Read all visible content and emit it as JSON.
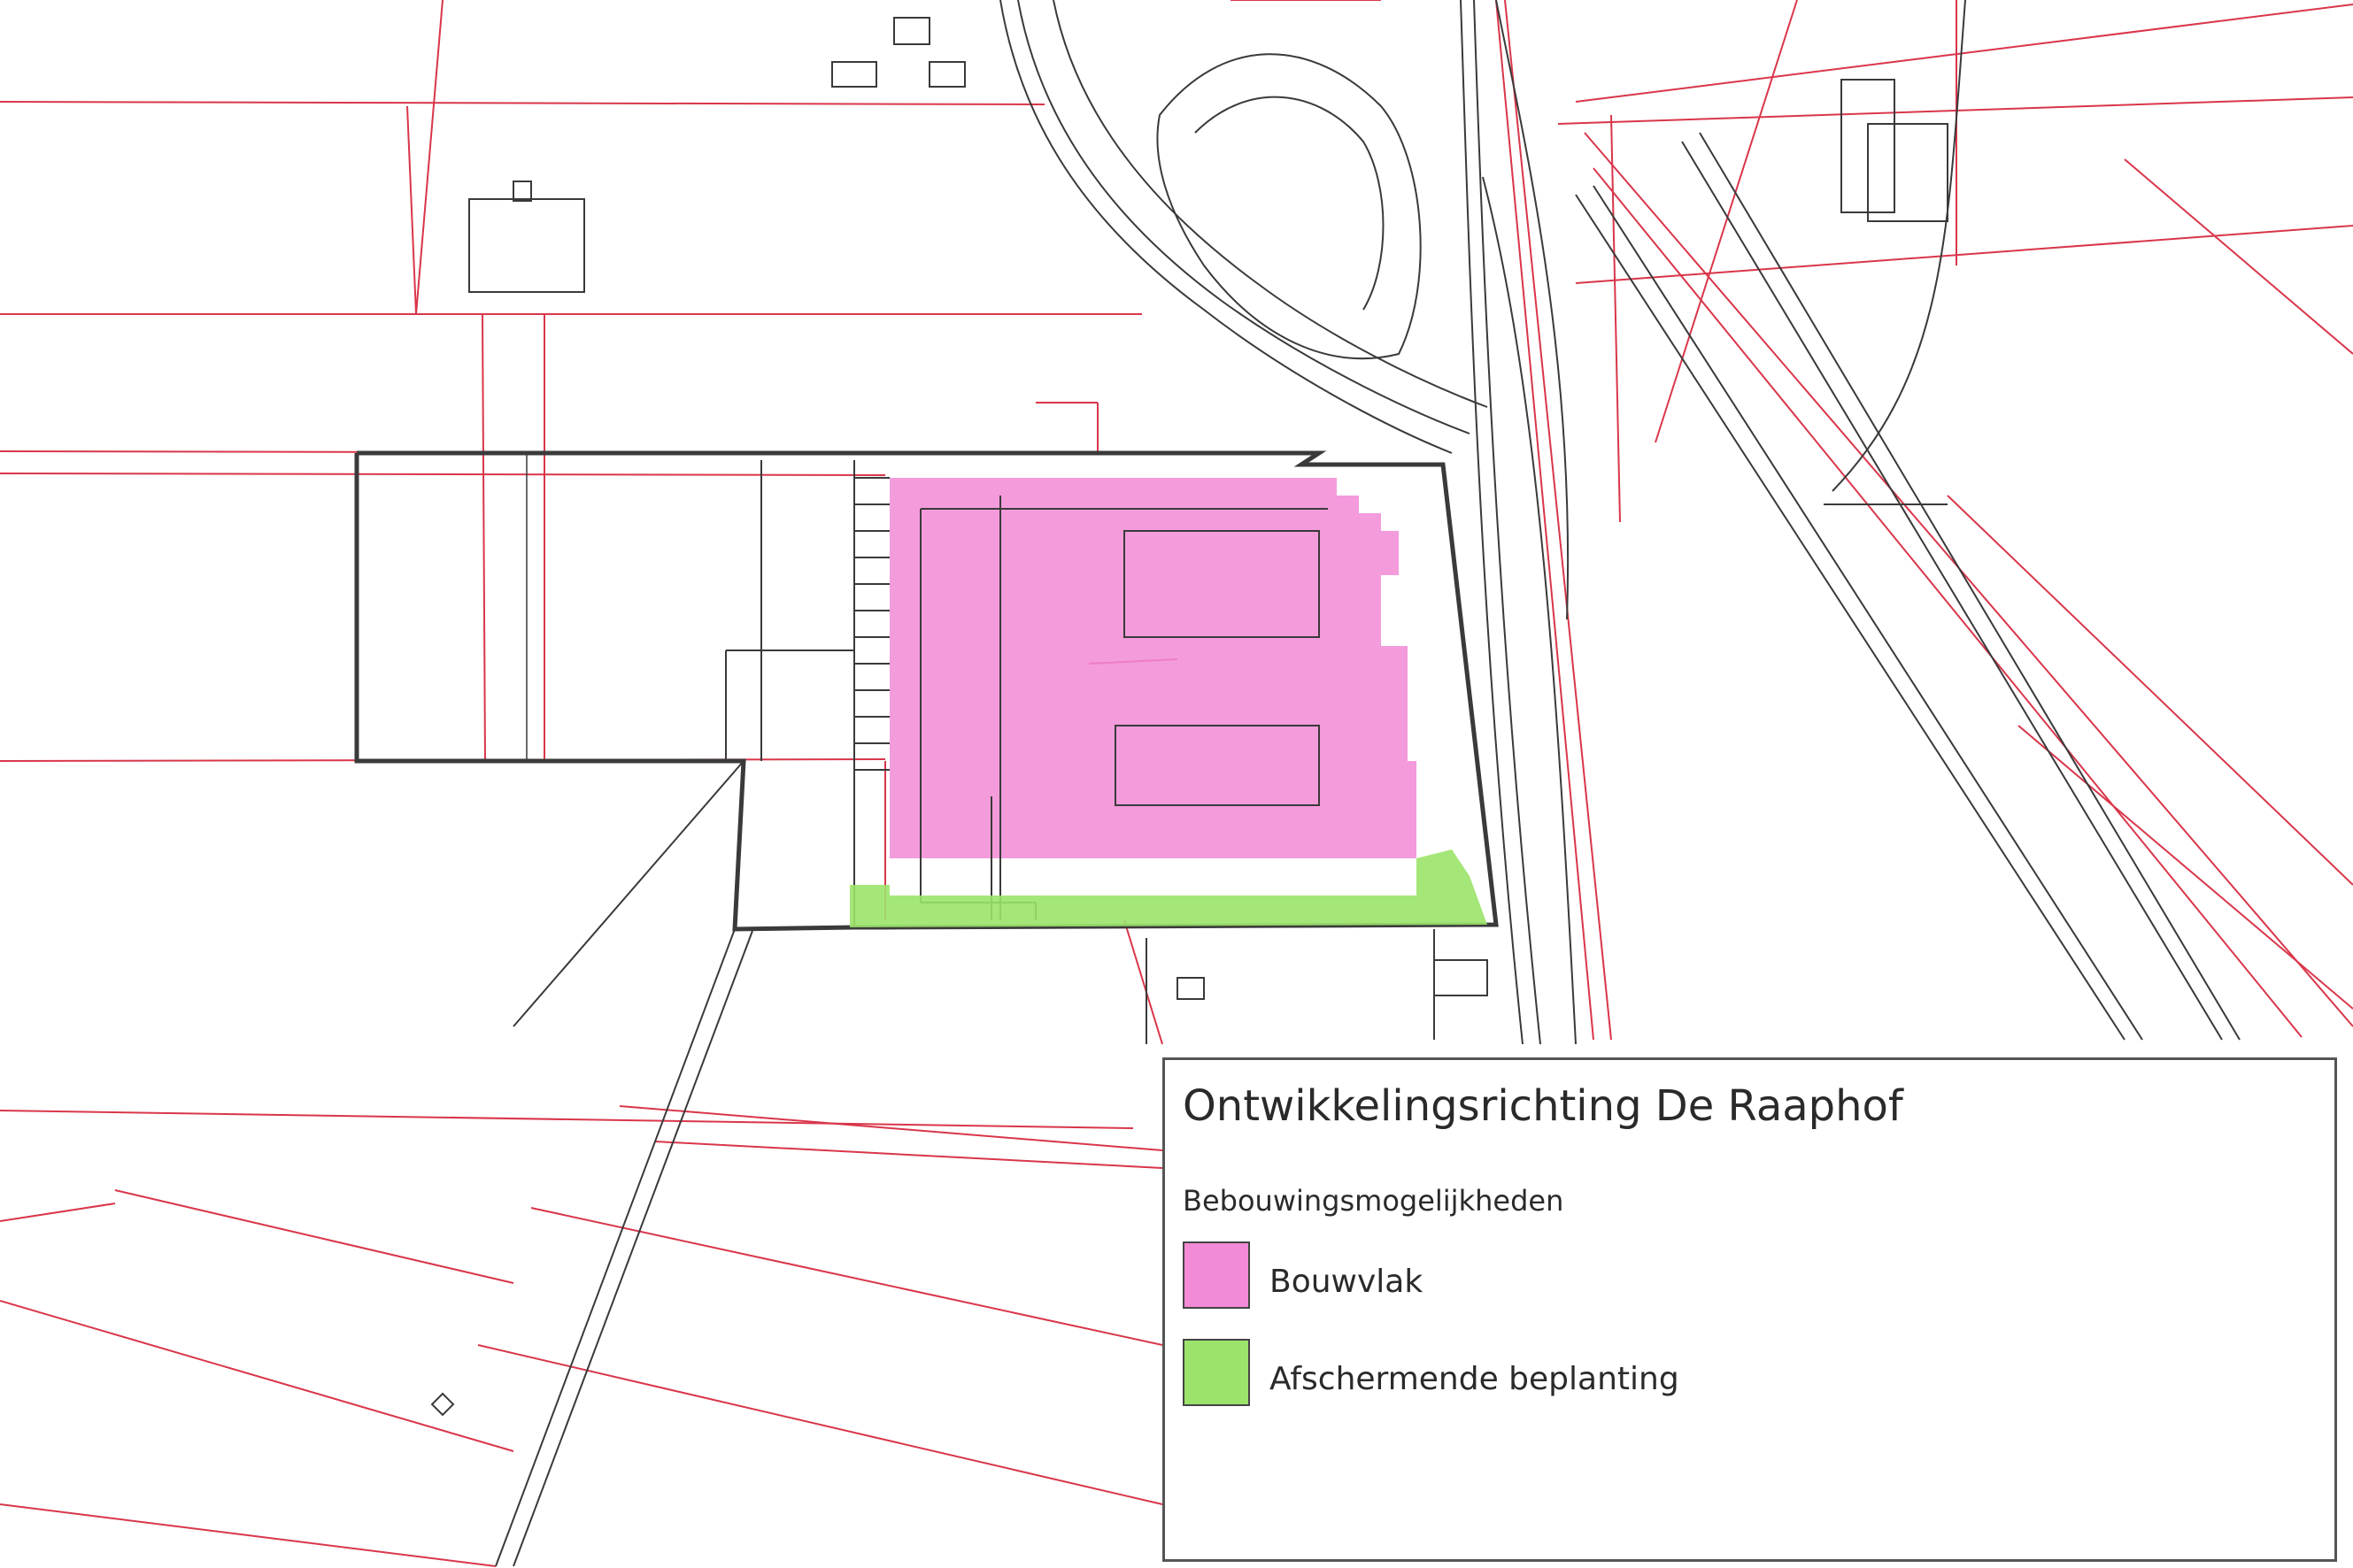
{
  "legend": {
    "title": "Ontwikkelingsrichting De Raaphof",
    "subtitle": "Bebouwingsmogelijkheden",
    "items": [
      {
        "label": "Bouwvlak",
        "color": "#f28ad6"
      },
      {
        "label": "Afschermende beplanting",
        "color": "#9be36a"
      }
    ]
  },
  "map": {
    "parcel_line_color": "#d9364a",
    "topo_line_color": "#3a3a3a",
    "zones": [
      {
        "name": "bouwvlak",
        "color": "#f28ad6"
      },
      {
        "name": "afschermende-beplanting",
        "color": "#9be36a"
      }
    ]
  }
}
